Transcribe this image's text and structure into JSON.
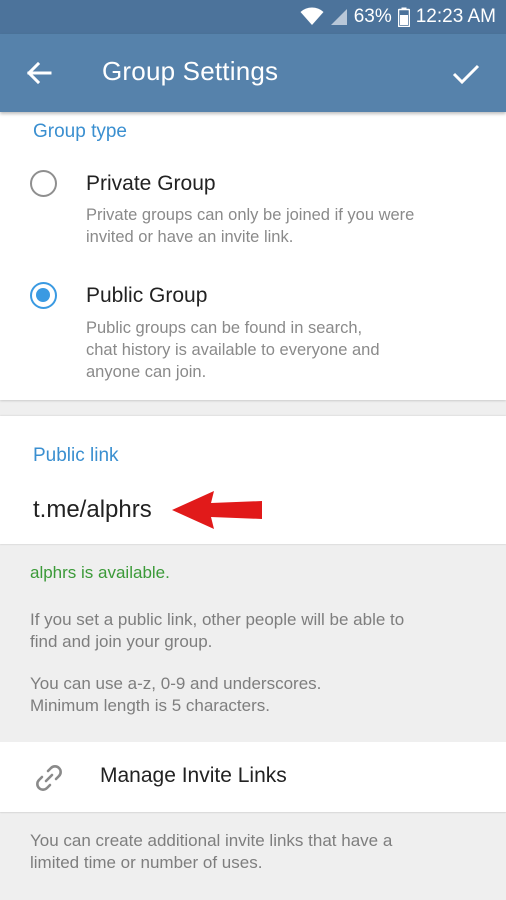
{
  "status": {
    "battery": "63%",
    "time": "12:23 AM"
  },
  "app_bar": {
    "title": "Group Settings"
  },
  "group_type": {
    "header": "Group type",
    "options": [
      {
        "title": "Private Group",
        "desc_lines": [
          "Private groups can only be joined if you were",
          "invited or have an invite link."
        ],
        "selected": false
      },
      {
        "title": "Public Group",
        "desc_lines": [
          "Public groups can be found in search,",
          "chat history is available to everyone and",
          "anyone can join."
        ],
        "selected": true
      }
    ]
  },
  "public_link": {
    "header": "Public link",
    "value": "t.me/alphrs"
  },
  "link_info": {
    "available": "alphrs is available.",
    "para1": [
      "If you set a public link, other people will be able to",
      "find and join your group."
    ],
    "para2": [
      "You can use a-z, 0-9 and underscores.",
      "Minimum length is 5 characters."
    ]
  },
  "manage": {
    "label": "Manage Invite Links",
    "icon": "link-icon"
  },
  "manage_info": [
    "You can create additional invite links that have a",
    "limited time or number of uses."
  ],
  "colors": {
    "app_bar": "#5682ab",
    "status_bar": "#4c739b",
    "accent": "#3a8fd0",
    "available": "#3b9a38",
    "arrow": "#e11a1a"
  }
}
